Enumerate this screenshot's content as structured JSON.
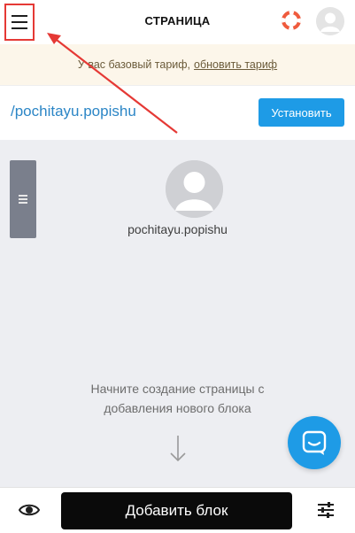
{
  "header": {
    "title": "СТРАНИЦА",
    "menu_icon": "hamburger-menu-icon",
    "help_icon": "lifebuoy-icon",
    "avatar_icon": "user-avatar-icon"
  },
  "notice": {
    "text": "У вас базовый тариф,",
    "link": "обновить тариф"
  },
  "url_bar": {
    "url": "/pochitayu.popishu",
    "install_label": "Установить"
  },
  "canvas": {
    "profile_name": "pochitayu.popishu",
    "hint_line1": "Начните создание страницы с",
    "hint_line2": "добавления нового блока"
  },
  "bottom_bar": {
    "add_block_label": "Добавить блок",
    "preview_icon": "eye-icon",
    "settings_icon": "sliders-icon"
  },
  "colors": {
    "accent": "#1e9be6",
    "annotation": "#e53935",
    "notice_bg": "#fcf6ea",
    "canvas_bg": "#edeef2",
    "link": "#2c86c6"
  }
}
